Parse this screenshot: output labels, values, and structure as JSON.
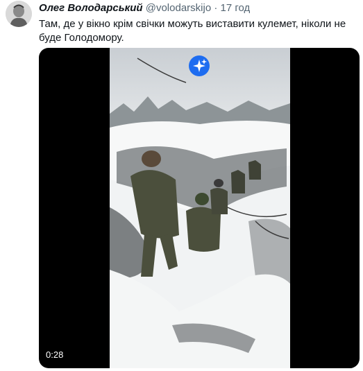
{
  "tweet": {
    "author_name": "Олег Володарський",
    "handle": "@volodarskijo",
    "separator": "·",
    "time": "17 год",
    "text": "Там, де у вікно крім свічки можуть виставити кулемет, ніколи не буде Голодомору."
  },
  "media": {
    "duration": "0:28",
    "badge_icon": "sparkle-icon"
  },
  "colors": {
    "name": "#0f1419",
    "secondary": "#536471",
    "media_bg": "#000000",
    "badge": "#1d6cf0"
  }
}
